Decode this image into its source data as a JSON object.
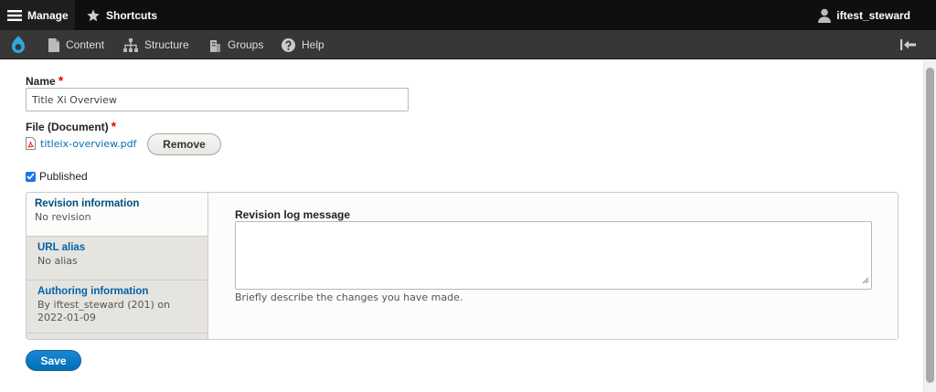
{
  "toolbar": {
    "manage_label": "Manage",
    "shortcuts_label": "Shortcuts",
    "user_label": "iftest_steward",
    "tray": {
      "content_label": "Content",
      "structure_label": "Structure",
      "groups_label": "Groups",
      "help_label": "Help"
    }
  },
  "form": {
    "name_label": "Name",
    "name_value": "Title Xi Overview",
    "required_marker": "*",
    "file_label": "File (Document)",
    "file_name": "titleix-overview.pdf",
    "remove_label": "Remove",
    "published_label": "Published",
    "published_checked": true,
    "save_label": "Save"
  },
  "vertical_tabs": {
    "tabs": [
      {
        "title": "Revision information",
        "summary": "No revision"
      },
      {
        "title": "URL alias",
        "summary": "No alias"
      },
      {
        "title": "Authoring information",
        "summary": "By iftest_steward (201) on 2022-01-09"
      }
    ],
    "pane": {
      "label": "Revision log message",
      "description": "Briefly describe the changes you have made."
    }
  },
  "colors": {
    "accent": "#0071b8",
    "toolbar_bg": "#0f0f0f",
    "tray_bg": "#373737",
    "required": "#e00000"
  }
}
